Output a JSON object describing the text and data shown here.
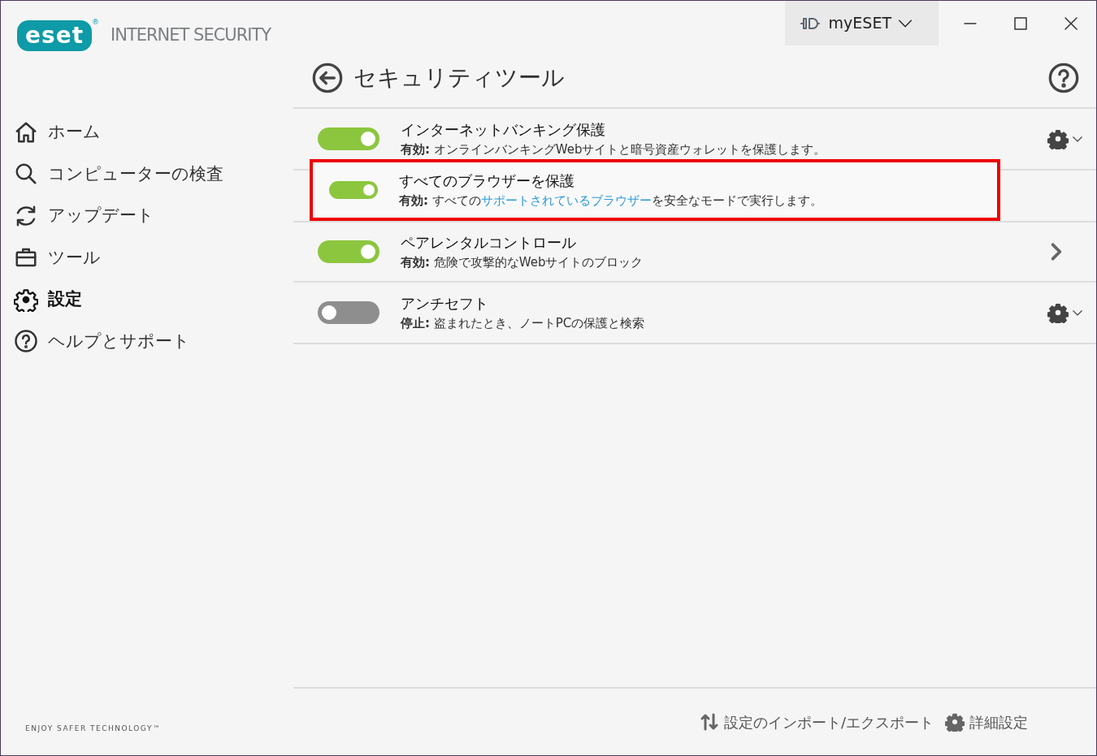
{
  "logo": {
    "mark": "eset",
    "registered": "®",
    "product": "INTERNET SECURITY"
  },
  "titlebar": {
    "account": "myESET"
  },
  "sidebar": {
    "items": [
      {
        "label": "ホーム",
        "kind": "home",
        "selected": false
      },
      {
        "label": "コンピューターの検査",
        "kind": "search",
        "selected": false
      },
      {
        "label": "アップデート",
        "kind": "refresh",
        "selected": false
      },
      {
        "label": "ツール",
        "kind": "toolbox",
        "selected": false
      },
      {
        "label": "設定",
        "kind": "gear",
        "selected": true
      },
      {
        "label": "ヘルプとサポート",
        "kind": "help",
        "selected": false
      }
    ],
    "tagline": "ENJOY SAFER TECHNOLOGY™"
  },
  "page": {
    "title": "セキュリティツール"
  },
  "features": [
    {
      "kind": "menu",
      "name": "インターネットバンキング保護",
      "on": true,
      "status": "有効:",
      "description": "オンラインバンキングWebサイトと暗号資産ウォレットを保護します。",
      "highlighted": false
    },
    {
      "kind": "plain",
      "name": "すべてのブラウザーを保護",
      "on": true,
      "status": "有効:",
      "description": "すべての",
      "link": "サポートされているブラウザー",
      "description_after": "を安全なモードで実行します。",
      "highlighted": true
    },
    {
      "kind": "arrow",
      "name": "ペアレンタルコントロール",
      "on": true,
      "status": "有効:",
      "description": "危険で攻撃的なWebサイトのブロック",
      "highlighted": false
    },
    {
      "kind": "menu",
      "name": "アンチセフト",
      "on": false,
      "status": "停止:",
      "description": "盗まれたとき、ノートPCの保護と検索",
      "highlighted": false
    }
  ],
  "footer": {
    "links": [
      {
        "label": "設定のインポート/エクスポート",
        "kind": "sort"
      },
      {
        "label": "詳細設定",
        "kind": "gear"
      }
    ]
  }
}
